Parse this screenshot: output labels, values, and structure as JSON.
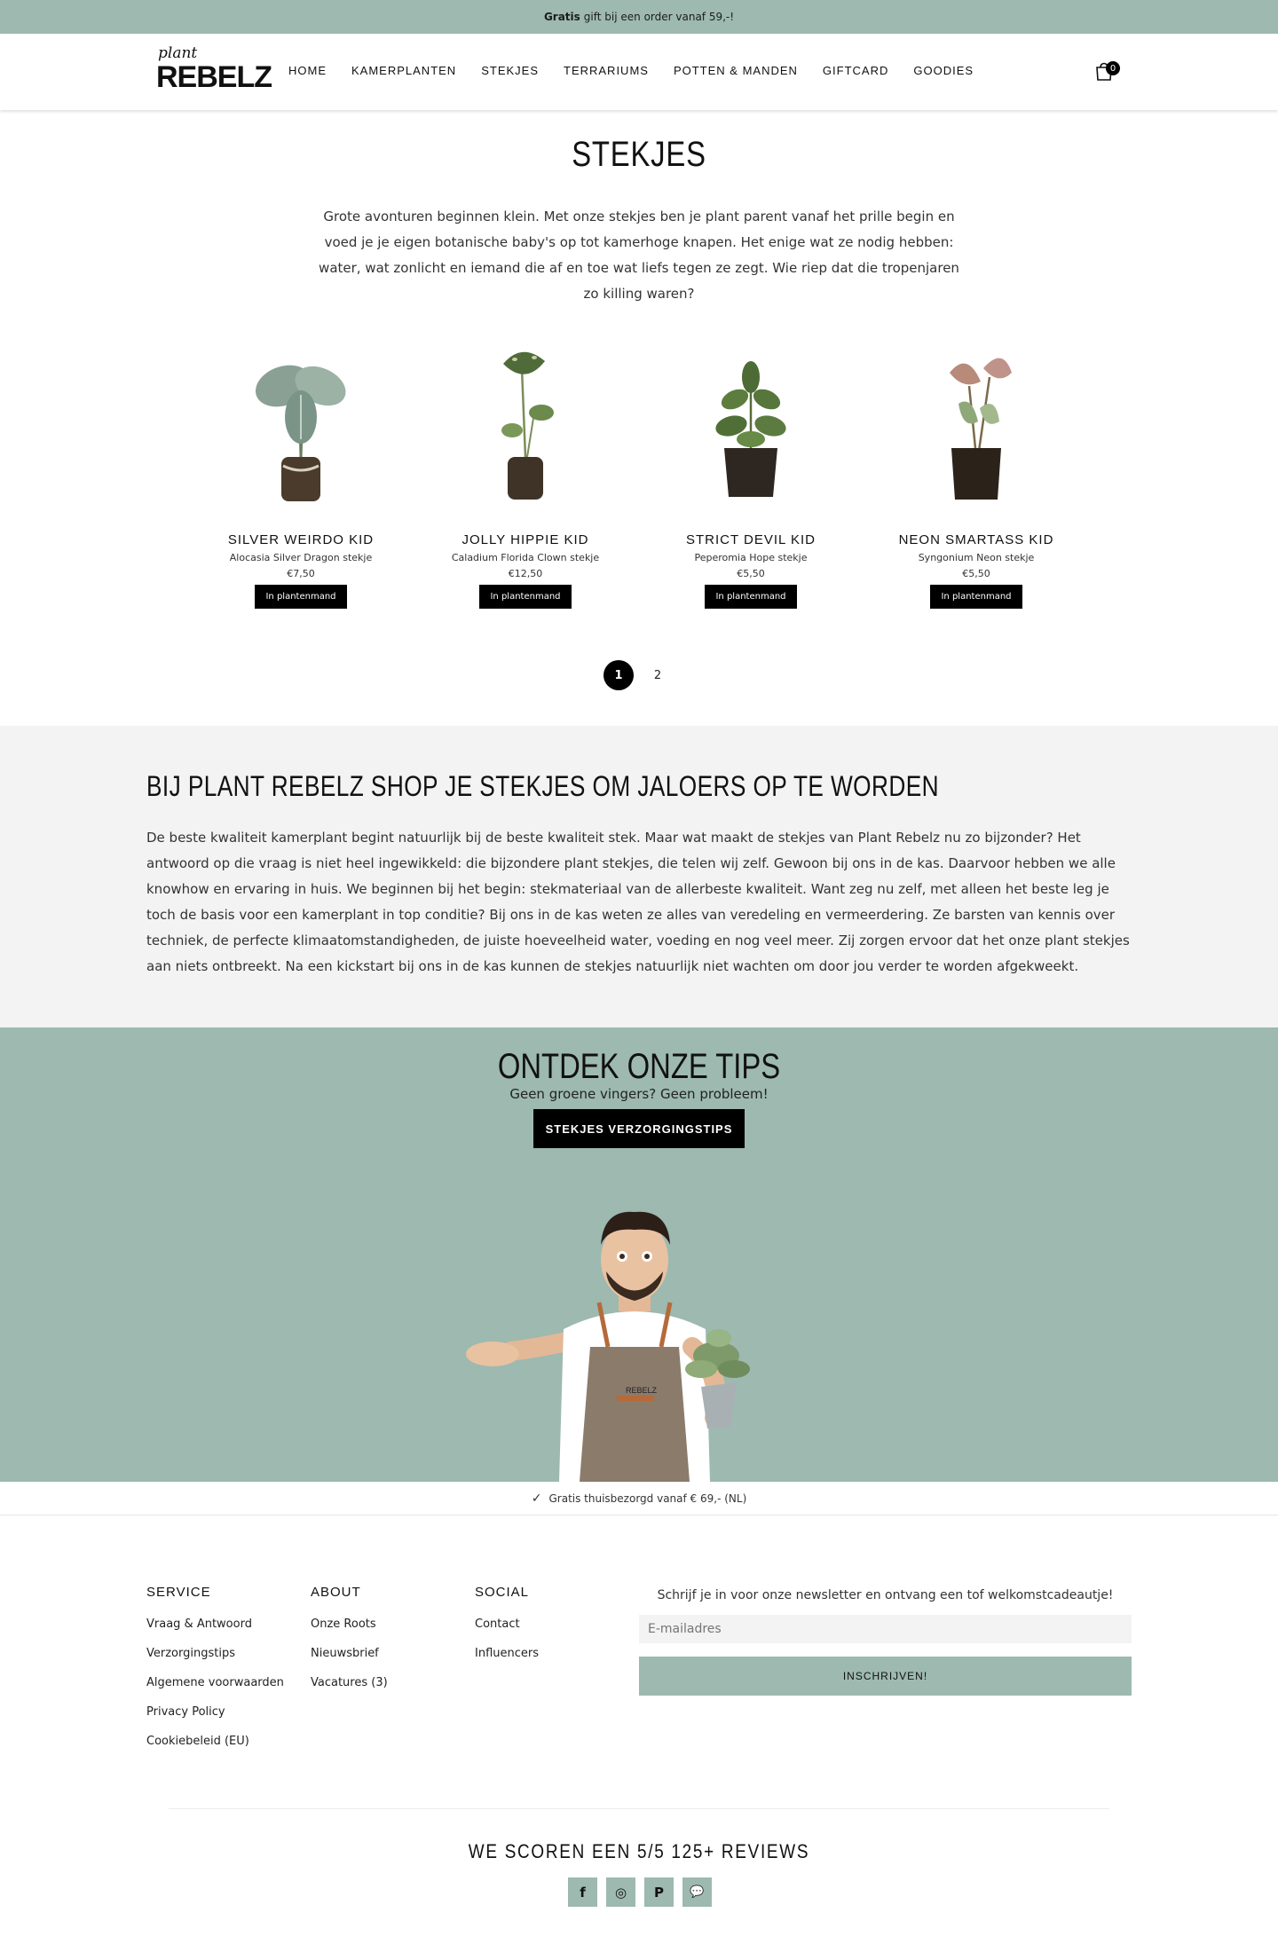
{
  "topbar": {
    "bold": "Gratis",
    "text": "gift bij een order vanaf 59,-!"
  },
  "logo": {
    "small": "plant",
    "big": "REBELZ"
  },
  "nav": [
    "HOME",
    "KAMERPLANTEN",
    "STEKJES",
    "TERRARIUMS",
    "POTTEN & MANDEN",
    "GIFTCARD",
    "GOODIES"
  ],
  "cart": {
    "count": "0"
  },
  "page": {
    "title": "STEKJES",
    "intro": "Grote avonturen beginnen klein. Met onze stekjes ben je plant parent vanaf het prille begin en voed je je eigen botanische baby's op tot kamerhoge knapen. Het enige wat ze nodig hebben: water, wat zonlicht en iemand die af en toe wat liefs tegen ze zegt. Wie riep dat die tropenjaren zo killing waren?"
  },
  "products": [
    {
      "name": "SILVER WEIRDO KID",
      "sub": "Alocasia Silver Dragon stekje",
      "price": "€7,50",
      "button": "In plantenmand"
    },
    {
      "name": "JOLLY HIPPIE KID",
      "sub": "Caladium Florida Clown stekje",
      "price": "€12,50",
      "button": "In plantenmand"
    },
    {
      "name": "STRICT DEVIL KID",
      "sub": "Peperomia Hope stekje",
      "price": "€5,50",
      "button": "In plantenmand"
    },
    {
      "name": "NEON SMARTASS KID",
      "sub": "Syngonium Neon stekje",
      "price": "€5,50",
      "button": "In plantenmand"
    }
  ],
  "pagination": [
    "1",
    "2"
  ],
  "seo": {
    "title": "BIJ PLANT REBELZ SHOP JE STEKJES OM JALOERS OP TE WORDEN",
    "text": "De beste kwaliteit kamerplant begint natuurlijk bij de beste kwaliteit stek. Maar wat maakt de stekjes van Plant Rebelz nu zo bijzonder? Het antwoord op die vraag is niet heel ingewikkeld: die bijzondere plant stekjes, die telen wij zelf. Gewoon bij ons in de kas. Daarvoor hebben we alle knowhow en ervaring in huis. We beginnen bij het begin: stekmateriaal van de allerbeste kwaliteit. Want zeg nu zelf, met alleen het beste leg je toch de basis voor een kamerplant in top conditie? Bij ons in de kas weten ze alles van veredeling en vermeerdering. Ze barsten van kennis over techniek, de perfecte klimaatomstandigheden, de juiste hoeveelheid water, voeding en nog veel meer. Zij zorgen ervoor dat het onze plant stekjes aan niets ontbreekt. Na een kickstart bij ons in de kas kunnen de stekjes natuurlijk niet wachten om door jou verder te worden afgekweekt."
  },
  "tips": {
    "title": "ONTDEK ONZE TIPS",
    "subtitle": "Geen groene vingers? Geen probleem!",
    "button": "STEKJES VERZORGINGSTIPS",
    "apron_text": "REBELZ"
  },
  "usp": {
    "check": "✓",
    "text": "Gratis thuisbezorgd vanaf € 69,- (NL)"
  },
  "footer": {
    "service": {
      "title": "SERVICE",
      "links": [
        "Vraag & Antwoord",
        "Verzorgingstips",
        "Algemene voorwaarden",
        "Privacy Policy",
        "Cookiebeleid (EU)"
      ]
    },
    "about": {
      "title": "ABOUT",
      "links": [
        "Onze Roots",
        "Nieuwsbrief",
        "Vacatures (3)"
      ]
    },
    "social": {
      "title": "SOCIAL",
      "links": [
        "Contact",
        "Influencers"
      ]
    },
    "newsletter": {
      "text": "Schrijf je in voor onze newsletter en ontvang een tof welkomstcadeautje!",
      "placeholder": "E-mailadres",
      "button": "INSCHRIJVEN!"
    }
  },
  "reviews": "WE SCOREN EEN 5/5 125+ REVIEWS",
  "social_icons": [
    {
      "icon": "facebook-icon",
      "glyph": "f"
    },
    {
      "icon": "instagram-icon",
      "glyph": "◎"
    },
    {
      "icon": "pinterest-icon",
      "glyph": "P"
    },
    {
      "icon": "chat-icon",
      "glyph": "💬"
    }
  ],
  "colors": {
    "accent": "#9db9b0",
    "button": "#000000",
    "seo_bg": "#f3f3f3"
  }
}
